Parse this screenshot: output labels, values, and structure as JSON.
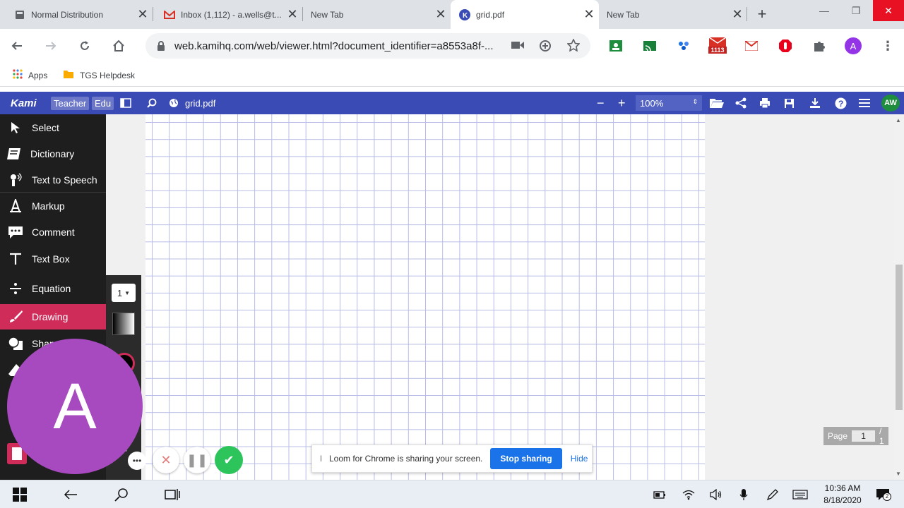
{
  "browser": {
    "tabs": [
      {
        "title": "Normal Distribution",
        "icon": "blank-page-icon"
      },
      {
        "title": "Inbox (1,112) - a.wells@t...",
        "icon": "gmail-icon"
      },
      {
        "title": "New Tab",
        "icon": ""
      },
      {
        "title": "grid.pdf",
        "icon": "kami-icon",
        "active": true
      },
      {
        "title": "New Tab",
        "icon": ""
      }
    ],
    "url": "web.kamihq.com/web/viewer.html?document_identifier=a8553a8f-...",
    "gmail_badge": "1113",
    "profile_initial": "A",
    "bookmarks": [
      {
        "label": "Apps",
        "icon": "apps-grid-icon"
      },
      {
        "label": "TGS Helpdesk",
        "icon": "folder-icon"
      }
    ]
  },
  "kami": {
    "logo": "Kami",
    "badge_teacher": "Teacher",
    "badge_edu": "Edu",
    "doc_name": "grid.pdf",
    "zoom": "100%",
    "user_initials": "AW",
    "accent": "#3b4bb5",
    "active_accent": "#cf2c5a",
    "tools": [
      {
        "label": "Select",
        "icon": "cursor-icon"
      },
      {
        "label": "Dictionary",
        "icon": "book-icon"
      },
      {
        "label": "Text to Speech",
        "icon": "speaker-icon"
      },
      {
        "label": "Markup",
        "icon": "markup-icon"
      },
      {
        "label": "Comment",
        "icon": "comment-icon"
      },
      {
        "label": "Text Box",
        "icon": "text-icon"
      },
      {
        "label": "Equation",
        "icon": "divide-icon"
      },
      {
        "label": "Drawing",
        "icon": "brush-icon",
        "active": true
      },
      {
        "label": "Shap",
        "icon": "shapes-icon"
      }
    ],
    "stroke_size": "1",
    "page_label": "Page",
    "page_current": "1",
    "page_total": "/ 1"
  },
  "loom": {
    "avatar_initial": "A",
    "avatar_color": "#a74abf",
    "banner_text": "Loom for Chrome is sharing your screen.",
    "stop_label": "Stop sharing",
    "hide_label": "Hide"
  },
  "taskbar": {
    "time": "10:36 AM",
    "date": "8/18/2020",
    "notification_count": "2"
  }
}
